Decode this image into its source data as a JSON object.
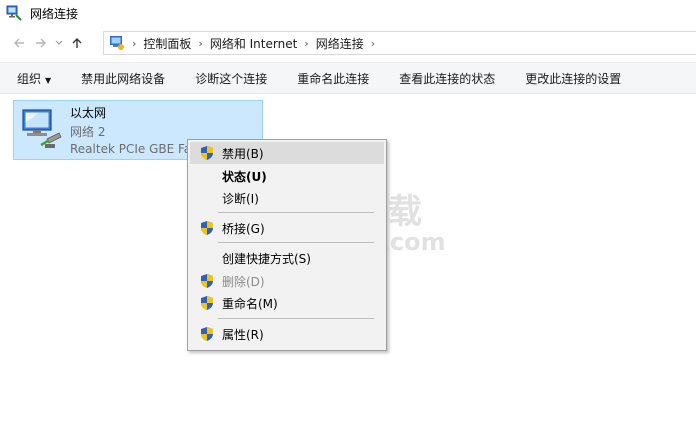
{
  "window": {
    "title": "网络连接"
  },
  "address": {
    "crumbs": [
      "控制面板",
      "网络和 Internet",
      "网络连接"
    ]
  },
  "toolbar": {
    "organize": "组织",
    "disable": "禁用此网络设备",
    "diagnose": "诊断这个连接",
    "rename": "重命名此连接",
    "view_status": "查看此连接的状态",
    "change_settings": "更改此连接的设置"
  },
  "adapter": {
    "name": "以太网",
    "network": "网络  2",
    "device": "Realtek PCIe GBE Fa"
  },
  "context_menu": {
    "items": [
      {
        "label": "禁用(B)",
        "shield": true,
        "state": "highlighted"
      },
      {
        "label": "状态(U)",
        "shield": false,
        "state": "default-bold"
      },
      {
        "label": "诊断(I)",
        "shield": false,
        "state": "normal"
      },
      {
        "label": "桥接(G)",
        "shield": true,
        "state": "normal"
      },
      {
        "label": "创建快捷方式(S)",
        "shield": false,
        "state": "normal"
      },
      {
        "label": "删除(D)",
        "shield": true,
        "state": "disabled"
      },
      {
        "label": "重命名(M)",
        "shield": true,
        "state": "normal"
      },
      {
        "label": "属性(R)",
        "shield": true,
        "state": "normal"
      }
    ]
  },
  "watermark": {
    "text": "安下载",
    "sub": "anxz.com"
  },
  "colors": {
    "selection": "#cce8ff",
    "selection_border": "#99d1ff",
    "menu_bg": "#f2f2f2",
    "menu_highlight": "#dcdcdc"
  }
}
